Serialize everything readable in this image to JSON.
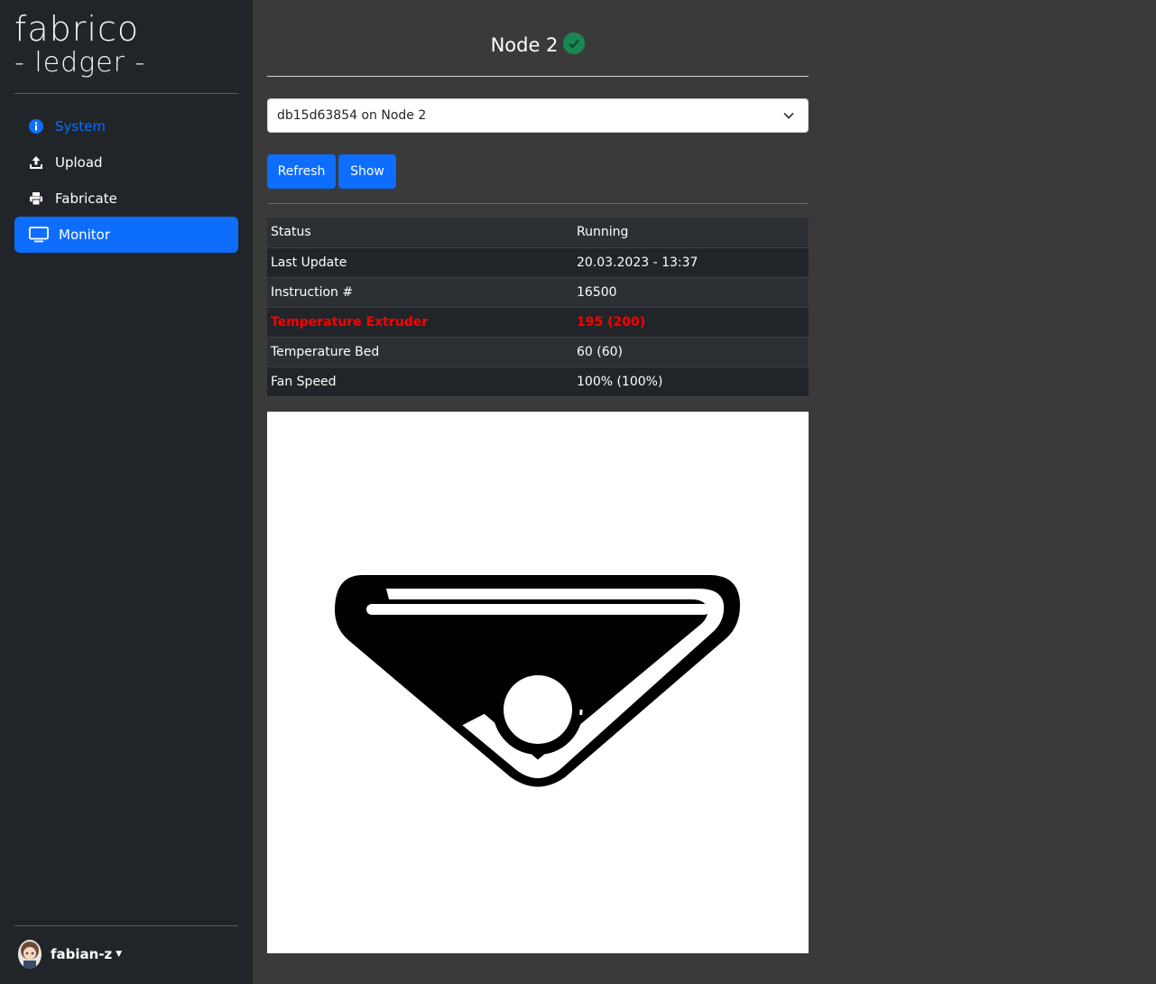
{
  "brand": {
    "line1": "fabrico",
    "line2": "- ledger -"
  },
  "nav": [
    {
      "label": "System",
      "icon": "info-icon"
    },
    {
      "label": "Upload",
      "icon": "upload-icon"
    },
    {
      "label": "Fabricate",
      "icon": "printer-icon"
    },
    {
      "label": "Monitor",
      "icon": "monitor-icon"
    }
  ],
  "user": {
    "name": "fabian-z"
  },
  "node": {
    "title": "Node 2",
    "status_icon": "check-circle-icon",
    "status_color": "#198754"
  },
  "job_select": {
    "value": "db15d63854 on Node 2"
  },
  "buttons": {
    "refresh": "Refresh",
    "show": "Show"
  },
  "status_table": [
    {
      "label": "Status",
      "value": "Running"
    },
    {
      "label": "Last Update",
      "value": "20.03.2023 - 13:37"
    },
    {
      "label": "Instruction #",
      "value": "16500"
    },
    {
      "label": "Temperature Extruder",
      "value": "195 (200)"
    },
    {
      "label": "Temperature Bed",
      "value": "60 (60)"
    },
    {
      "label": "Fan Speed",
      "value": "100% (100%)"
    }
  ],
  "colors": {
    "accent": "#0d6efd",
    "sidebar_bg": "#212529",
    "page_bg": "#3a3a3a",
    "alert": "#ff0000"
  }
}
